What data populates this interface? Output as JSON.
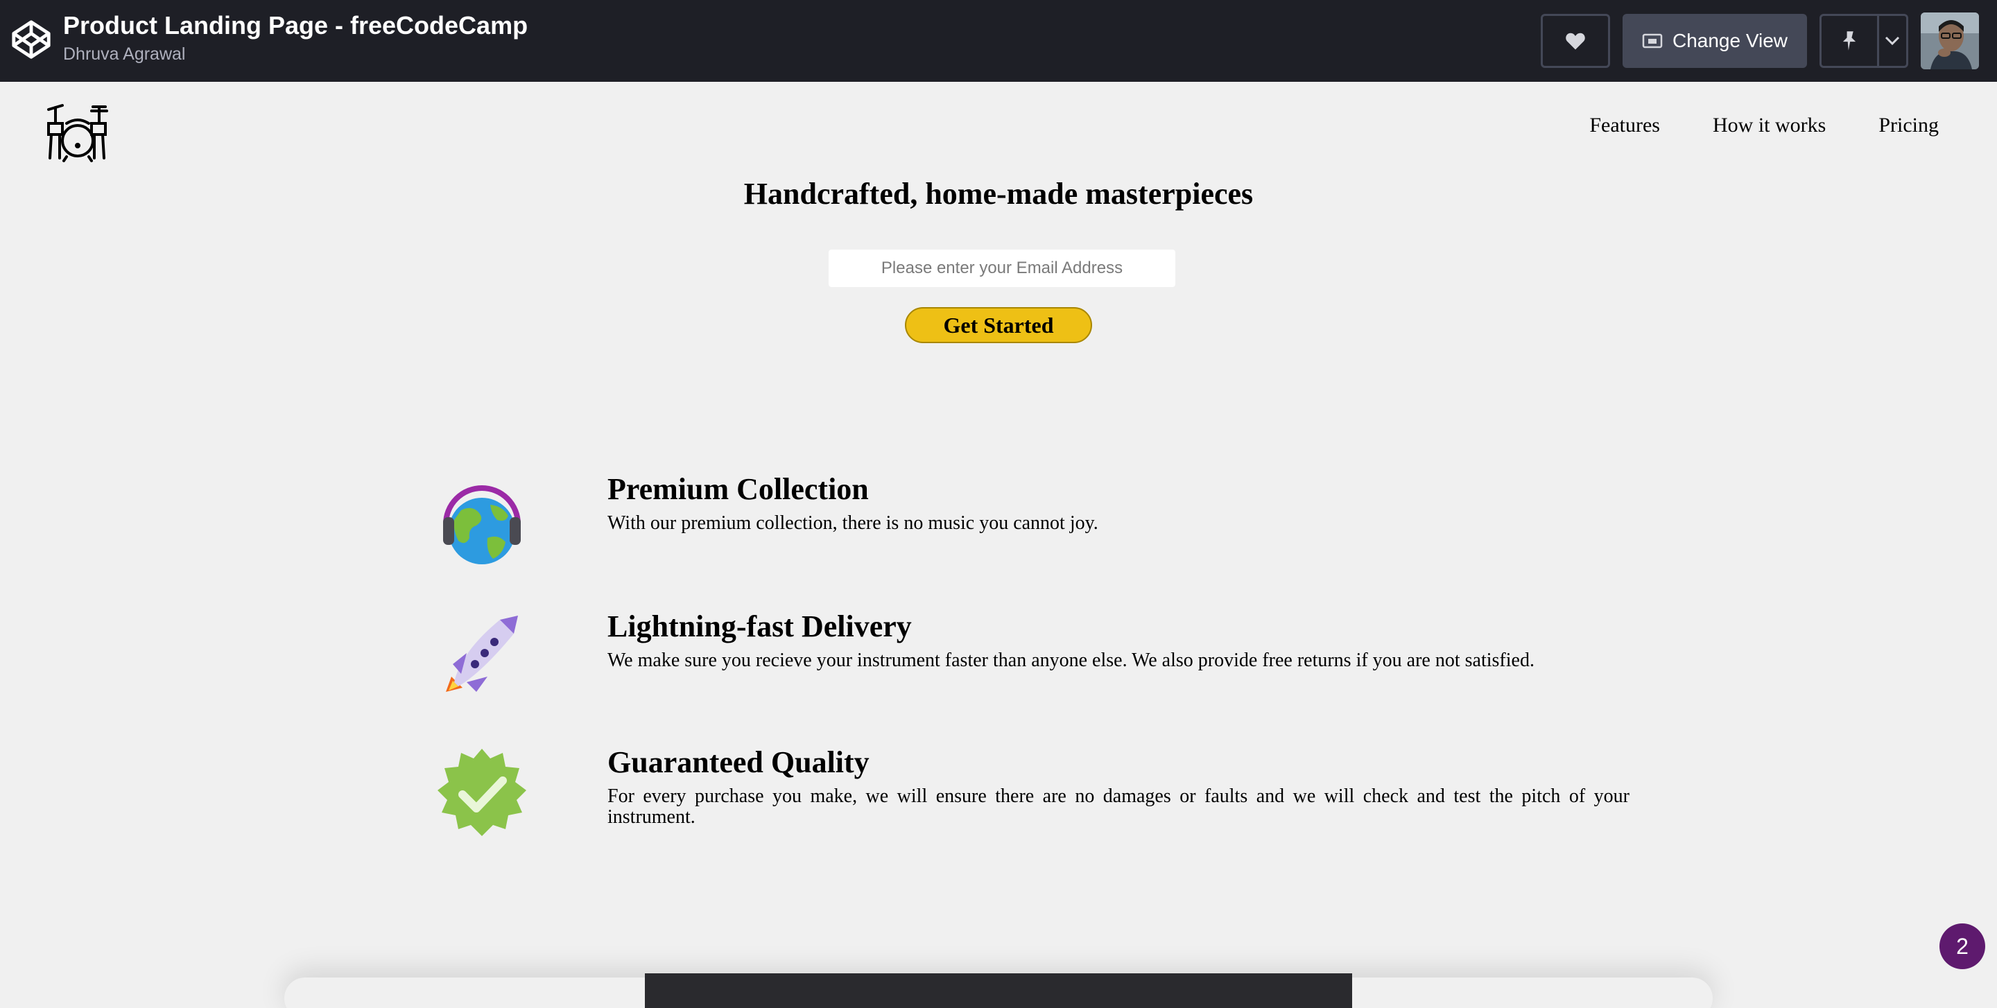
{
  "codepen": {
    "title": "Product Landing Page - freeCodeCamp",
    "author": "Dhruva Agrawal",
    "change_view_label": "Change View"
  },
  "nav": {
    "items": [
      "Features",
      "How it works",
      "Pricing"
    ]
  },
  "hero": {
    "title": "Handcrafted, home-made masterpieces",
    "email_placeholder": "Please enter your Email Address",
    "cta_label": "Get Started"
  },
  "features": [
    {
      "icon": "globe-headphones-icon",
      "title": "Premium Collection",
      "description": "With our premium collection, there is no music you cannot joy."
    },
    {
      "icon": "rocket-icon",
      "title": "Lightning-fast Delivery",
      "description": "We make sure you recieve your instrument faster than anyone else. We also provide free returns if you are not satisfied."
    },
    {
      "icon": "check-badge-icon",
      "title": "Guaranteed Quality",
      "description": "For every purchase you make, we will ensure there are no damages or faults and we will check and test the pitch of your instrument."
    }
  ],
  "notification_badge": "2",
  "colors": {
    "topbar": "#1e1f26",
    "cta": "#eec015",
    "badge": "#5e1a6e"
  }
}
